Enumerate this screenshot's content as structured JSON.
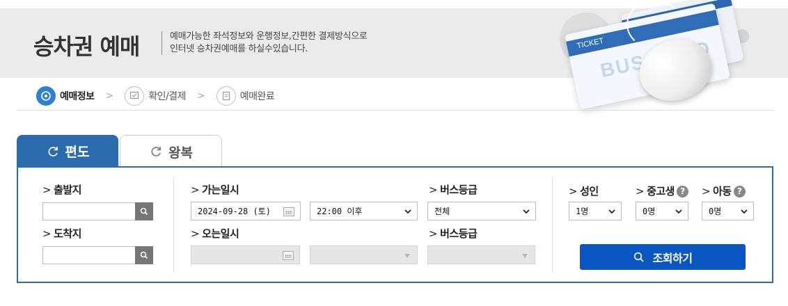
{
  "header": {
    "title": "승차권 예매",
    "desc_line1": "예매가능한 좌석정보와 운행정보,간편한 결제방식으로",
    "desc_line2": "인터넷 승차권예매를 하실수있습니다.",
    "ticket_label": "TICKET",
    "ticket_brand": "BUS TAGO"
  },
  "steps": [
    {
      "label": "예매정보",
      "icon": "location-pin-icon",
      "active": true
    },
    {
      "label": "확인/결제",
      "icon": "monitor-icon",
      "active": false
    },
    {
      "label": "예매완료",
      "icon": "document-icon",
      "active": false
    }
  ],
  "step_arrow": ">",
  "tabs": {
    "one_way": "편도",
    "round_trip": "왕복"
  },
  "form": {
    "departure_label": "출발지",
    "arrival_label": "도착지",
    "depart_datetime_label": "가는일시",
    "return_datetime_label": "오는일시",
    "bus_grade_label": "버스등급",
    "bus_grade_label2": "버스등급",
    "departure_value": "",
    "arrival_value": "",
    "depart_date": "2024-09-28 (토)",
    "depart_time": "22:00 이후",
    "bus_grade": "전체",
    "return_date": "",
    "return_time": "",
    "return_grade": ""
  },
  "passengers": {
    "adult_label": "성인",
    "youth_label": "중고생",
    "child_label": "아동",
    "help_mark": "?",
    "adult_value": "1명",
    "youth_value": "0명",
    "child_value": "0명"
  },
  "search_button": "조회하기",
  "colors": {
    "primary": "#2c6bae",
    "button": "#0a57c3",
    "step_active": "#2f80d1"
  }
}
